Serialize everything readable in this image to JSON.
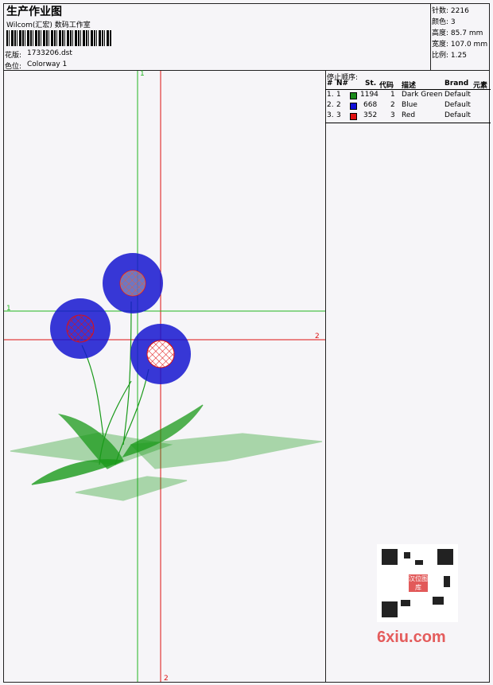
{
  "header": {
    "title": "生产作业图",
    "company": "Wilcom(汇宏) 数码工作室",
    "design_label": "花版:",
    "design_value": "1733206.dst",
    "colorway_label": "色位:",
    "colorway_value": "Colorway 1"
  },
  "stats": [
    {
      "label": "针数:",
      "value": "2216"
    },
    {
      "label": "颜色:",
      "value": "3"
    },
    {
      "label": "高度:",
      "value": "85.7 mm"
    },
    {
      "label": "宽度:",
      "value": "107.0 mm"
    },
    {
      "label": "比例:",
      "value": "1.25"
    }
  ],
  "stop_sequence": {
    "title": "停止顺序:",
    "headers": {
      "hash": "#",
      "n": "N#",
      "st": "St.",
      "code": "代码",
      "desc": "描述",
      "brand": "Brand",
      "elem": "元素"
    },
    "rows": [
      {
        "hash": "1.",
        "n": "1",
        "color": "#1a8a1a",
        "st": "1194",
        "code": "1",
        "desc": "Dark Green",
        "brand": "Default"
      },
      {
        "hash": "2.",
        "n": "2",
        "color": "#1010d8",
        "st": "668",
        "code": "2",
        "desc": "Blue",
        "brand": "Default"
      },
      {
        "hash": "3.",
        "n": "3",
        "color": "#e01010",
        "st": "352",
        "code": "3",
        "desc": "Red",
        "brand": "Default"
      }
    ]
  },
  "guides": {
    "green_v": "1",
    "green_h": "1",
    "red_h": "2",
    "red_v": "2"
  },
  "colors": {
    "green": "#21b521",
    "red": "#d11",
    "blue": "#1515d0",
    "leaf": "#1a9a1a"
  },
  "watermark": {
    "qr_seal": "汉位图库",
    "text": "6xiu.com"
  }
}
